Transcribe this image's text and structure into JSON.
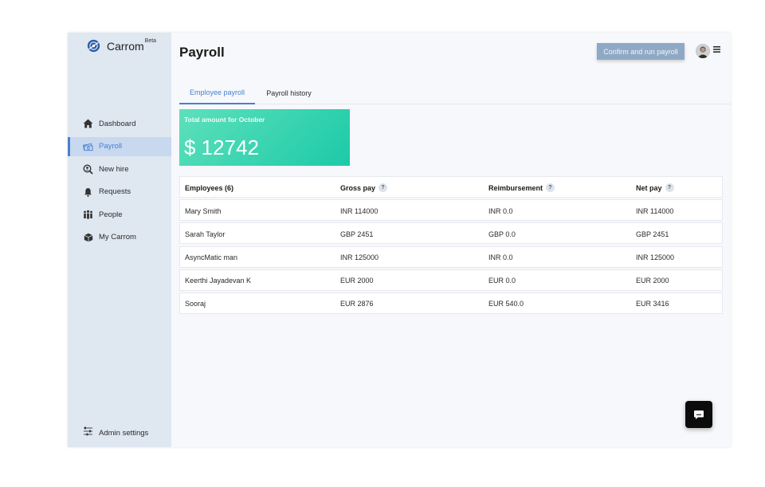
{
  "brand": {
    "name": "Carrom",
    "badge": "Beta"
  },
  "sidebar": {
    "items": [
      {
        "label": "Dashboard",
        "icon": "home-icon"
      },
      {
        "label": "Payroll",
        "icon": "money-icon",
        "active": true
      },
      {
        "label": "New hire",
        "icon": "search-user-icon"
      },
      {
        "label": "Requests",
        "icon": "bell-icon"
      },
      {
        "label": "People",
        "icon": "people-icon"
      },
      {
        "label": "My Carrom",
        "icon": "box-icon"
      }
    ],
    "admin": {
      "label": "Admin settings",
      "icon": "sliders-icon"
    }
  },
  "header": {
    "title": "Payroll",
    "run_button": "Confirm and run payroll",
    "avatar_icon": "avatar-icon",
    "menu_icon": "hamburger-menu-icon"
  },
  "tabs": [
    {
      "label": "Employee payroll",
      "active": true
    },
    {
      "label": "Payroll history",
      "active": false
    }
  ],
  "summary": {
    "label": "Total amount for October",
    "value": "$ 12742"
  },
  "table": {
    "headers": [
      "Employees (6)",
      "Gross pay",
      "Reimbursement",
      "Net pay"
    ],
    "help_glyph": "?",
    "rows": [
      [
        "Mary Smith",
        "INR 114000",
        "INR 0.0",
        "INR 114000"
      ],
      [
        "Sarah Taylor",
        "GBP 2451",
        "GBP 0.0",
        "GBP 2451"
      ],
      [
        "AsyncMatic man",
        "INR 125000",
        "INR 0.0",
        "INR 125000"
      ],
      [
        "Keerthi Jayadevan K",
        "EUR 2000",
        "EUR 0.0",
        "EUR 2000"
      ],
      [
        "Sooraj",
        "EUR 2876",
        "EUR 540.0",
        "EUR 3416"
      ]
    ]
  },
  "colors": {
    "accent": "#4a7fd1",
    "sidebar_bg": "#dfe7f1",
    "card_gradient_start": "#5de0bb",
    "card_gradient_end": "#1ccaa8",
    "run_button_bg": "#8fa9c5"
  },
  "chat_icon": "chat-bubble-icon"
}
